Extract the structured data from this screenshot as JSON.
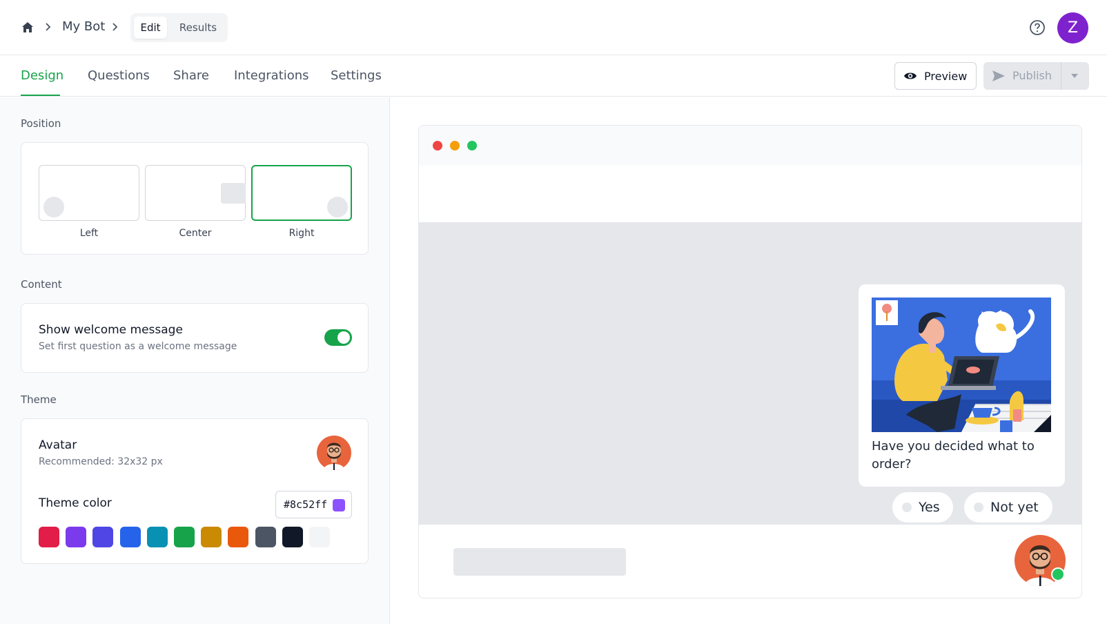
{
  "breadcrumb": {
    "bot_name": "My Bot"
  },
  "mode_toggle": {
    "edit": "Edit",
    "results": "Results"
  },
  "user": {
    "initial": "Z"
  },
  "tabs": [
    {
      "label": "Design",
      "active": true
    },
    {
      "label": "Questions"
    },
    {
      "label": "Share"
    },
    {
      "label": "Integrations"
    },
    {
      "label": "Settings"
    }
  ],
  "actions": {
    "preview": "Preview",
    "publish": "Publish"
  },
  "position": {
    "label": "Position",
    "options": [
      "Left",
      "Center",
      "Right"
    ],
    "selected": "Right"
  },
  "content": {
    "label": "Content",
    "welcome_title": "Show welcome message",
    "welcome_sub": "Set first question as a welcome message",
    "welcome_enabled": true
  },
  "theme": {
    "label": "Theme",
    "avatar_title": "Avatar",
    "avatar_sub": "Recommended: 32x32 px",
    "color_title": "Theme color",
    "color_value": "#8c52ff",
    "swatches": [
      "#e11d48",
      "#7c3aed",
      "#4f46e5",
      "#2563eb",
      "#0891b2",
      "#16a34a",
      "#ca8a04",
      "#ea580c",
      "#4b5563",
      "#111827",
      "#f3f4f6"
    ]
  },
  "preview_widget": {
    "question": "Have you decided what to order?",
    "answers": [
      "Yes",
      "Not yet"
    ]
  },
  "colors": {
    "accent": "#16a34a",
    "window_red": "#ef4444",
    "window_yellow": "#f59e0b",
    "window_green": "#22c55e"
  }
}
